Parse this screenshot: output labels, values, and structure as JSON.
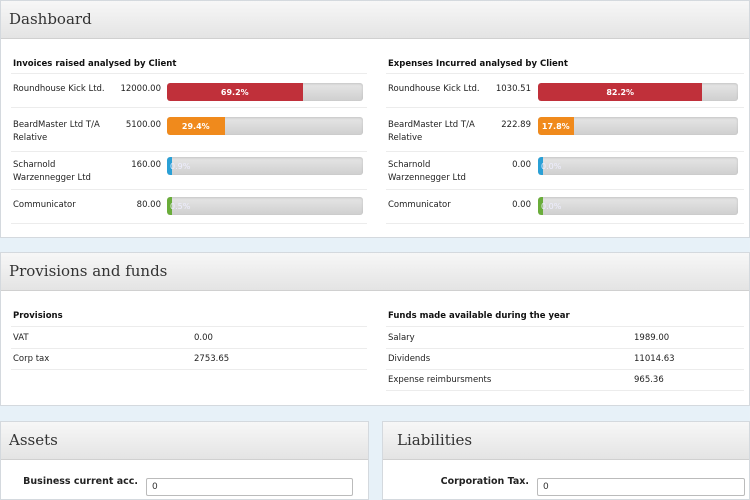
{
  "dashboard": {
    "title": "Dashboard",
    "invoices": {
      "title": "Invoices raised analysed by Client",
      "rows": [
        {
          "label": "Roundhouse Kick Ltd.",
          "value": "12000.00",
          "pct_label": "69.2%",
          "fraction": 0.692,
          "color": "#c0303a"
        },
        {
          "label": "BeardMaster Ltd T/A Relative",
          "value": "5100.00",
          "pct_label": "29.4%",
          "fraction": 0.294,
          "color": "#f08a1c"
        },
        {
          "label": "Scharnold Warzennegger Ltd",
          "value": "160.00",
          "pct_label": "0.9%",
          "fraction": 0.009,
          "color": "#2aa0d6"
        },
        {
          "label": "Communicator",
          "value": "80.00",
          "pct_label": "0.5%",
          "fraction": 0.005,
          "color": "#6aad3a"
        }
      ]
    },
    "expenses": {
      "title": "Expenses Incurred analysed by Client",
      "rows": [
        {
          "label": "Roundhouse Kick Ltd.",
          "value": "1030.51",
          "pct_label": "82.2%",
          "fraction": 0.822,
          "color": "#c0303a"
        },
        {
          "label": "BeardMaster Ltd T/A Relative",
          "value": "222.89",
          "pct_label": "17.8%",
          "fraction": 0.178,
          "color": "#f08a1c"
        },
        {
          "label": "Scharnold Warzennegger Ltd",
          "value": "0.00",
          "pct_label": "0.0%",
          "fraction": 0.0,
          "color": "#2aa0d6"
        },
        {
          "label": "Communicator",
          "value": "0.00",
          "pct_label": "0.0%",
          "fraction": 0.0,
          "color": "#6aad3a"
        }
      ]
    }
  },
  "provisions_funds": {
    "title": "Provisions and funds",
    "provisions": {
      "title": "Provisions",
      "rows": [
        {
          "label": "VAT",
          "value": "0.00"
        },
        {
          "label": "Corp tax",
          "value": "2753.65"
        }
      ]
    },
    "funds": {
      "title": "Funds made available during the year",
      "rows": [
        {
          "label": "Salary",
          "value": "1989.00"
        },
        {
          "label": "Dividends",
          "value": "11014.63"
        },
        {
          "label": "Expense reimbursments",
          "value": "965.36"
        }
      ]
    }
  },
  "assets": {
    "title": "Assets",
    "field_label": "Business current acc.",
    "field_value": "0"
  },
  "liabilities": {
    "title": "Liabilities",
    "field_label": "Corporation Tax.",
    "field_value": "0"
  }
}
